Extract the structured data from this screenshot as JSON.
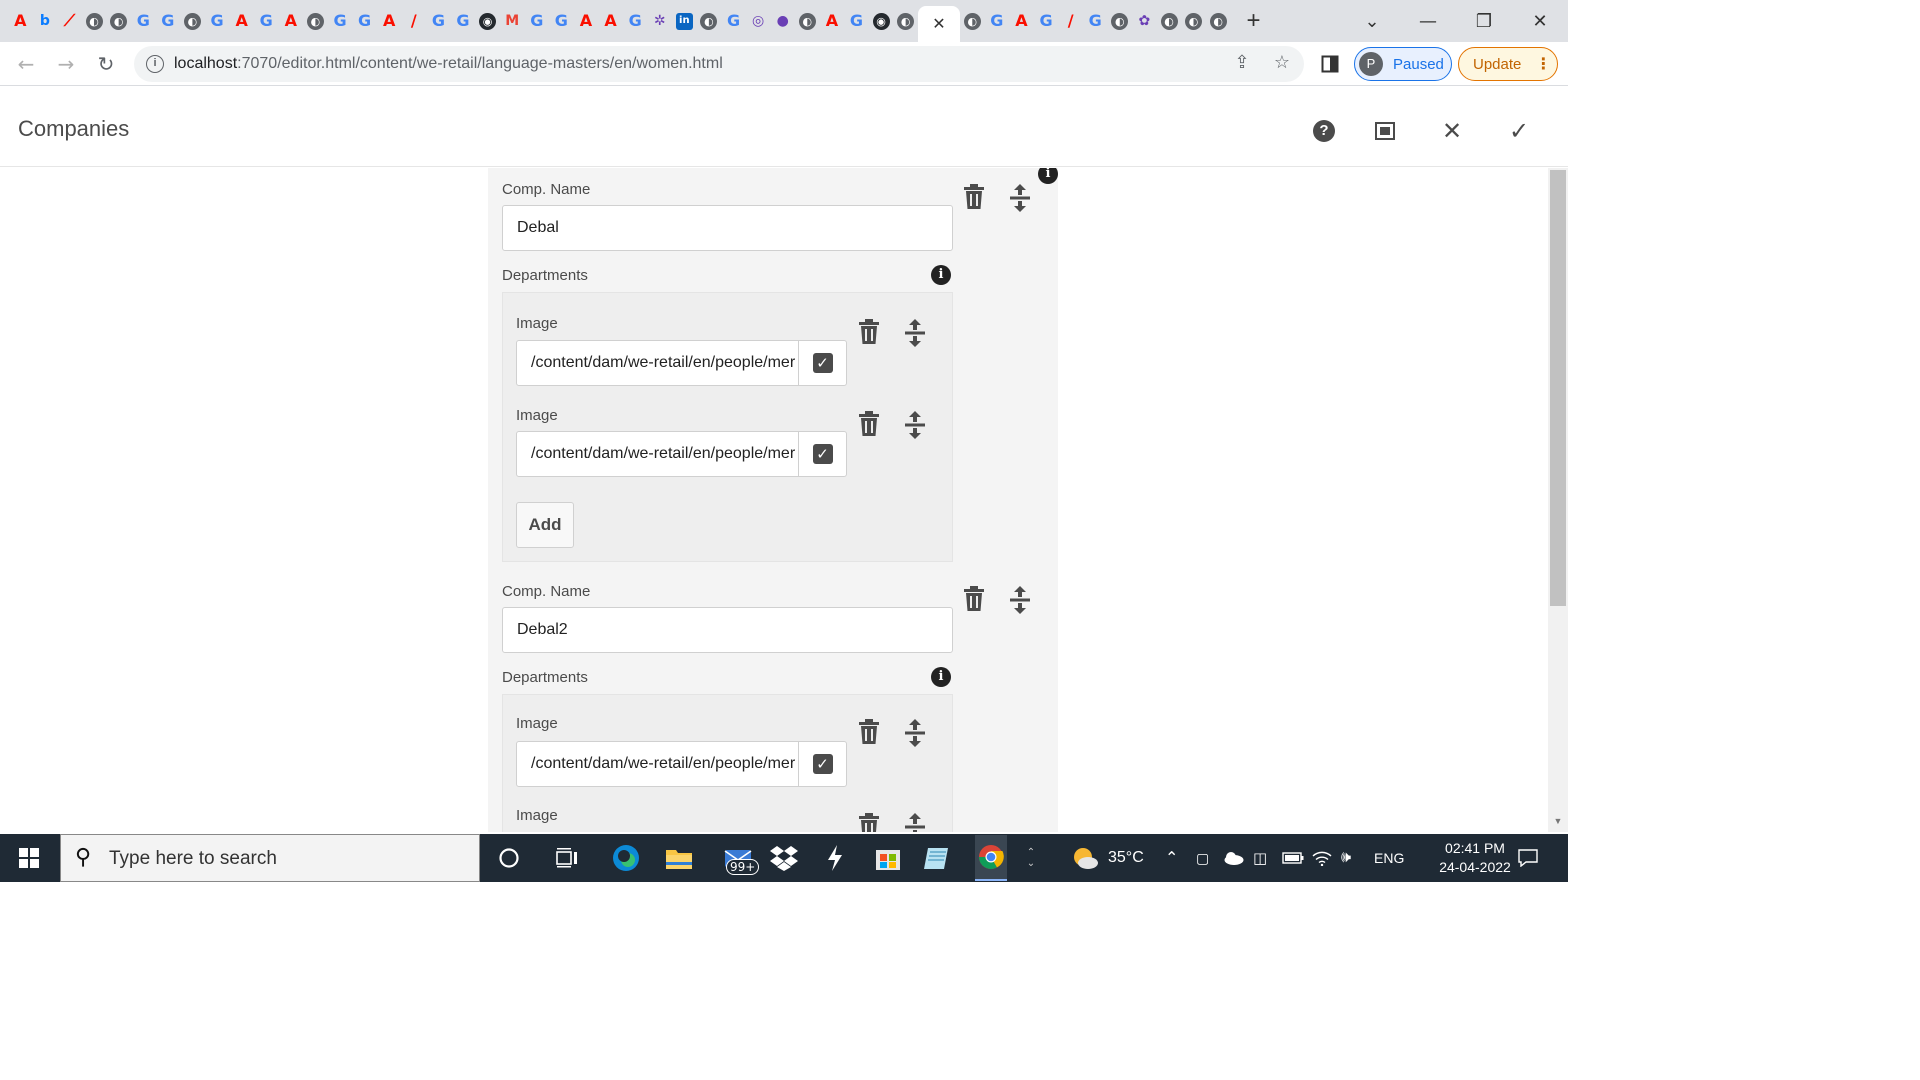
{
  "browser": {
    "tab_favicons": [
      {
        "kind": "adobe",
        "glyph": "A"
      },
      {
        "kind": "bing",
        "glyph": "b"
      },
      {
        "kind": "adobe",
        "glyph": "⟋"
      },
      {
        "kind": "globe",
        "glyph": "◐"
      },
      {
        "kind": "globe",
        "glyph": "◐"
      },
      {
        "kind": "google",
        "glyph": "G"
      },
      {
        "kind": "google",
        "glyph": "G"
      },
      {
        "kind": "globe",
        "glyph": "◐"
      },
      {
        "kind": "google",
        "glyph": "G"
      },
      {
        "kind": "adobe",
        "glyph": "A"
      },
      {
        "kind": "google",
        "glyph": "G"
      },
      {
        "kind": "adobe",
        "glyph": "A"
      },
      {
        "kind": "globe",
        "glyph": "◐"
      },
      {
        "kind": "google",
        "glyph": "G"
      },
      {
        "kind": "google",
        "glyph": "G"
      },
      {
        "kind": "adobe",
        "glyph": "A"
      },
      {
        "kind": "adobe",
        "glyph": "/"
      },
      {
        "kind": "google",
        "glyph": "G"
      },
      {
        "kind": "google",
        "glyph": "G"
      },
      {
        "kind": "github",
        "glyph": "◉"
      },
      {
        "kind": "gmail",
        "glyph": "M"
      },
      {
        "kind": "google",
        "glyph": "G"
      },
      {
        "kind": "google",
        "glyph": "G"
      },
      {
        "kind": "adobe",
        "glyph": "A"
      },
      {
        "kind": "adobe",
        "glyph": "A"
      },
      {
        "kind": "google",
        "glyph": "G"
      },
      {
        "kind": "other",
        "glyph": "✲"
      },
      {
        "kind": "linkedin",
        "glyph": "in"
      },
      {
        "kind": "globe",
        "glyph": "◐"
      },
      {
        "kind": "google",
        "glyph": "G"
      },
      {
        "kind": "other",
        "glyph": "◎"
      },
      {
        "kind": "other",
        "glyph": "●"
      },
      {
        "kind": "globe",
        "glyph": "◐"
      },
      {
        "kind": "adobe",
        "glyph": "A"
      },
      {
        "kind": "google",
        "glyph": "G"
      },
      {
        "kind": "github",
        "glyph": "◉"
      },
      {
        "kind": "globe",
        "glyph": "◐"
      },
      {
        "kind": "active",
        "glyph": "✕"
      },
      {
        "kind": "globe",
        "glyph": "◐"
      },
      {
        "kind": "google",
        "glyph": "G"
      },
      {
        "kind": "adobe",
        "glyph": "A"
      },
      {
        "kind": "google",
        "glyph": "G"
      },
      {
        "kind": "adobe",
        "glyph": "/"
      },
      {
        "kind": "google",
        "glyph": "G"
      },
      {
        "kind": "globe",
        "glyph": "◐"
      },
      {
        "kind": "other",
        "glyph": "✿"
      },
      {
        "kind": "globe",
        "glyph": "◐"
      },
      {
        "kind": "globe",
        "glyph": "◐"
      },
      {
        "kind": "globe",
        "glyph": "◐"
      }
    ],
    "new_tab": "+",
    "url_host": "localhost",
    "url_rest": ":7070/editor.html/content/we-retail/language-masters/en/women.html",
    "profile_initial": "P",
    "profile_status": "Paused",
    "update_label": "Update",
    "accent_color": "#1a73e8",
    "update_color": "#e37400"
  },
  "dialog": {
    "title": "Companies",
    "companies": [
      {
        "name_label": "Comp. Name",
        "name_value": "Debal",
        "departments_label": "Departments",
        "images": [
          {
            "label": "Image",
            "value": "/content/dam/we-retail/en/people/mer"
          },
          {
            "label": "Image",
            "value": "/content/dam/we-retail/en/people/mer"
          }
        ],
        "add_label": "Add"
      },
      {
        "name_label": "Comp. Name",
        "name_value": "Debal2",
        "departments_label": "Departments",
        "images": [
          {
            "label": "Image",
            "value": "/content/dam/we-retail/en/people/mer"
          },
          {
            "label": "Image",
            "value": ""
          }
        ]
      }
    ]
  },
  "taskbar": {
    "search_placeholder": "Type here to search",
    "notification_badge": "99+",
    "weather": "35°C",
    "language": "ENG",
    "time": "02:41 PM",
    "date": "24-04-2022"
  }
}
